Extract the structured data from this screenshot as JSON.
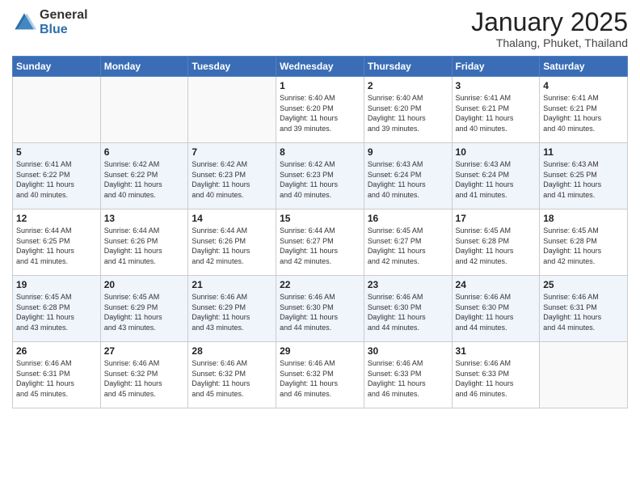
{
  "header": {
    "logo_general": "General",
    "logo_blue": "Blue",
    "month_title": "January 2025",
    "subtitle": "Thalang, Phuket, Thailand"
  },
  "weekdays": [
    "Sunday",
    "Monday",
    "Tuesday",
    "Wednesday",
    "Thursday",
    "Friday",
    "Saturday"
  ],
  "weeks": [
    [
      {
        "day": "",
        "info": ""
      },
      {
        "day": "",
        "info": ""
      },
      {
        "day": "",
        "info": ""
      },
      {
        "day": "1",
        "info": "Sunrise: 6:40 AM\nSunset: 6:20 PM\nDaylight: 11 hours\nand 39 minutes."
      },
      {
        "day": "2",
        "info": "Sunrise: 6:40 AM\nSunset: 6:20 PM\nDaylight: 11 hours\nand 39 minutes."
      },
      {
        "day": "3",
        "info": "Sunrise: 6:41 AM\nSunset: 6:21 PM\nDaylight: 11 hours\nand 40 minutes."
      },
      {
        "day": "4",
        "info": "Sunrise: 6:41 AM\nSunset: 6:21 PM\nDaylight: 11 hours\nand 40 minutes."
      }
    ],
    [
      {
        "day": "5",
        "info": "Sunrise: 6:41 AM\nSunset: 6:22 PM\nDaylight: 11 hours\nand 40 minutes."
      },
      {
        "day": "6",
        "info": "Sunrise: 6:42 AM\nSunset: 6:22 PM\nDaylight: 11 hours\nand 40 minutes."
      },
      {
        "day": "7",
        "info": "Sunrise: 6:42 AM\nSunset: 6:23 PM\nDaylight: 11 hours\nand 40 minutes."
      },
      {
        "day": "8",
        "info": "Sunrise: 6:42 AM\nSunset: 6:23 PM\nDaylight: 11 hours\nand 40 minutes."
      },
      {
        "day": "9",
        "info": "Sunrise: 6:43 AM\nSunset: 6:24 PM\nDaylight: 11 hours\nand 40 minutes."
      },
      {
        "day": "10",
        "info": "Sunrise: 6:43 AM\nSunset: 6:24 PM\nDaylight: 11 hours\nand 41 minutes."
      },
      {
        "day": "11",
        "info": "Sunrise: 6:43 AM\nSunset: 6:25 PM\nDaylight: 11 hours\nand 41 minutes."
      }
    ],
    [
      {
        "day": "12",
        "info": "Sunrise: 6:44 AM\nSunset: 6:25 PM\nDaylight: 11 hours\nand 41 minutes."
      },
      {
        "day": "13",
        "info": "Sunrise: 6:44 AM\nSunset: 6:26 PM\nDaylight: 11 hours\nand 41 minutes."
      },
      {
        "day": "14",
        "info": "Sunrise: 6:44 AM\nSunset: 6:26 PM\nDaylight: 11 hours\nand 42 minutes."
      },
      {
        "day": "15",
        "info": "Sunrise: 6:44 AM\nSunset: 6:27 PM\nDaylight: 11 hours\nand 42 minutes."
      },
      {
        "day": "16",
        "info": "Sunrise: 6:45 AM\nSunset: 6:27 PM\nDaylight: 11 hours\nand 42 minutes."
      },
      {
        "day": "17",
        "info": "Sunrise: 6:45 AM\nSunset: 6:28 PM\nDaylight: 11 hours\nand 42 minutes."
      },
      {
        "day": "18",
        "info": "Sunrise: 6:45 AM\nSunset: 6:28 PM\nDaylight: 11 hours\nand 42 minutes."
      }
    ],
    [
      {
        "day": "19",
        "info": "Sunrise: 6:45 AM\nSunset: 6:28 PM\nDaylight: 11 hours\nand 43 minutes."
      },
      {
        "day": "20",
        "info": "Sunrise: 6:45 AM\nSunset: 6:29 PM\nDaylight: 11 hours\nand 43 minutes."
      },
      {
        "day": "21",
        "info": "Sunrise: 6:46 AM\nSunset: 6:29 PM\nDaylight: 11 hours\nand 43 minutes."
      },
      {
        "day": "22",
        "info": "Sunrise: 6:46 AM\nSunset: 6:30 PM\nDaylight: 11 hours\nand 44 minutes."
      },
      {
        "day": "23",
        "info": "Sunrise: 6:46 AM\nSunset: 6:30 PM\nDaylight: 11 hours\nand 44 minutes."
      },
      {
        "day": "24",
        "info": "Sunrise: 6:46 AM\nSunset: 6:30 PM\nDaylight: 11 hours\nand 44 minutes."
      },
      {
        "day": "25",
        "info": "Sunrise: 6:46 AM\nSunset: 6:31 PM\nDaylight: 11 hours\nand 44 minutes."
      }
    ],
    [
      {
        "day": "26",
        "info": "Sunrise: 6:46 AM\nSunset: 6:31 PM\nDaylight: 11 hours\nand 45 minutes."
      },
      {
        "day": "27",
        "info": "Sunrise: 6:46 AM\nSunset: 6:32 PM\nDaylight: 11 hours\nand 45 minutes."
      },
      {
        "day": "28",
        "info": "Sunrise: 6:46 AM\nSunset: 6:32 PM\nDaylight: 11 hours\nand 45 minutes."
      },
      {
        "day": "29",
        "info": "Sunrise: 6:46 AM\nSunset: 6:32 PM\nDaylight: 11 hours\nand 46 minutes."
      },
      {
        "day": "30",
        "info": "Sunrise: 6:46 AM\nSunset: 6:33 PM\nDaylight: 11 hours\nand 46 minutes."
      },
      {
        "day": "31",
        "info": "Sunrise: 6:46 AM\nSunset: 6:33 PM\nDaylight: 11 hours\nand 46 minutes."
      },
      {
        "day": "",
        "info": ""
      }
    ]
  ]
}
